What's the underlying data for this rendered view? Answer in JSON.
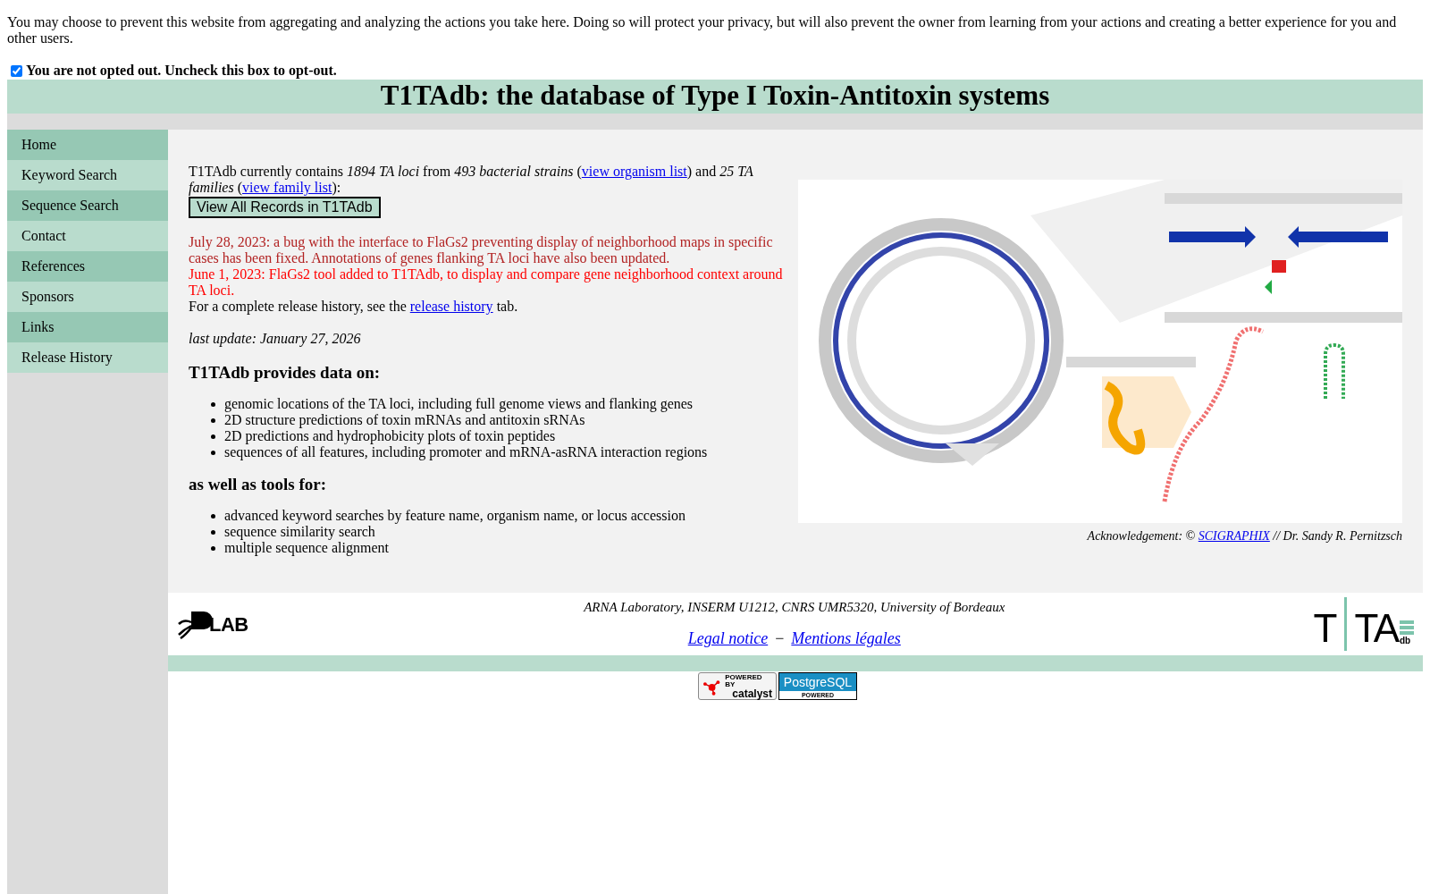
{
  "privacy": {
    "text": "You may choose to prevent this website from aggregating and analyzing the actions you take here. Doing so will protect your privacy, but will also prevent the owner from learning from your actions and creating a better experience for you and other users.",
    "optout_label": "You are not opted out. Uncheck this box to opt-out.",
    "checked": true
  },
  "title": "T1TAdb: the database of Type I Toxin-Antitoxin systems",
  "nav": [
    {
      "label": "Home"
    },
    {
      "label": "Keyword Search"
    },
    {
      "label": "Sequence Search"
    },
    {
      "label": "Contact"
    },
    {
      "label": "References"
    },
    {
      "label": "Sponsors"
    },
    {
      "label": "Links"
    },
    {
      "label": "Release History"
    }
  ],
  "intro": [
    {
      "kind": "text",
      "text": "T1TAdb currently contains *1894 TA loci* from *493 bacterial strains* ("
    },
    {
      "kind": "link",
      "text": "view organism list"
    },
    {
      "kind": "text",
      "text": ") and *25 TA families* ("
    },
    {
      "kind": "link",
      "text": "view family list"
    },
    {
      "kind": "text",
      "text": "):"
    }
  ],
  "records_button": "View All Records in T1TAdb",
  "news": [
    {
      "text": "July 28, 2023: a bug with the interface to FlaGs2 preventing display of neighborhood maps in specific cases has been fixed. Annotations of genes flanking TA loci have also been updated.",
      "color": "#b22222"
    },
    {
      "text": "June 1, 2023: FlaGs2 tool added to T1TAdb, to display and compare gene neighborhood context around TA loci.",
      "color": "#ff0000"
    }
  ],
  "release_note": [
    {
      "kind": "text",
      "text": "For a complete release history, see the "
    },
    {
      "kind": "link",
      "text": "release history"
    },
    {
      "kind": "text",
      "text": " tab."
    }
  ],
  "last_update": "last update: January 27, 2026",
  "data_heading": "T1TAdb provides data on:",
  "data_items": [
    "genomic locations of the TA loci, including full genome views and flanking genes",
    "2D structure predictions of toxin mRNAs and antitoxin sRNAs",
    "2D predictions and hydrophobicity plots of toxin peptides",
    "sequences of all features, including promoter and mRNA-asRNA interaction regions"
  ],
  "tools_heading": "as well as tools for:",
  "tool_items": [
    "advanced keyword searches by feature name, organism name, or locus accession",
    "sequence similarity search",
    "multiple sequence alignment"
  ],
  "figure": {
    "kind": "picture",
    "acknowledgement": [
      {
        "kind": "text",
        "text": "Acknowledgement: © "
      },
      {
        "kind": "link",
        "text": "SCIGRAPHIX"
      },
      {
        "kind": "text",
        "text": " // Dr. Sandy R. Pernitzsch"
      }
    ]
  },
  "footer": {
    "affiliation": "ARNA Laboratory, INSERM U1212, CNRS UMR5320, University of Bordeaux",
    "links": [
      "Legal notice",
      "Mentions légales"
    ],
    "separator": "−",
    "left_logo": "LAB",
    "right_logo": {
      "left": "T",
      "right": "TA",
      "small": "db"
    }
  },
  "badges": {
    "catalyst": {
      "top": "POWERED BY",
      "main": "catalyst"
    },
    "postgres": {
      "main": "PostgreSQL",
      "bottom": "POWERED"
    }
  }
}
